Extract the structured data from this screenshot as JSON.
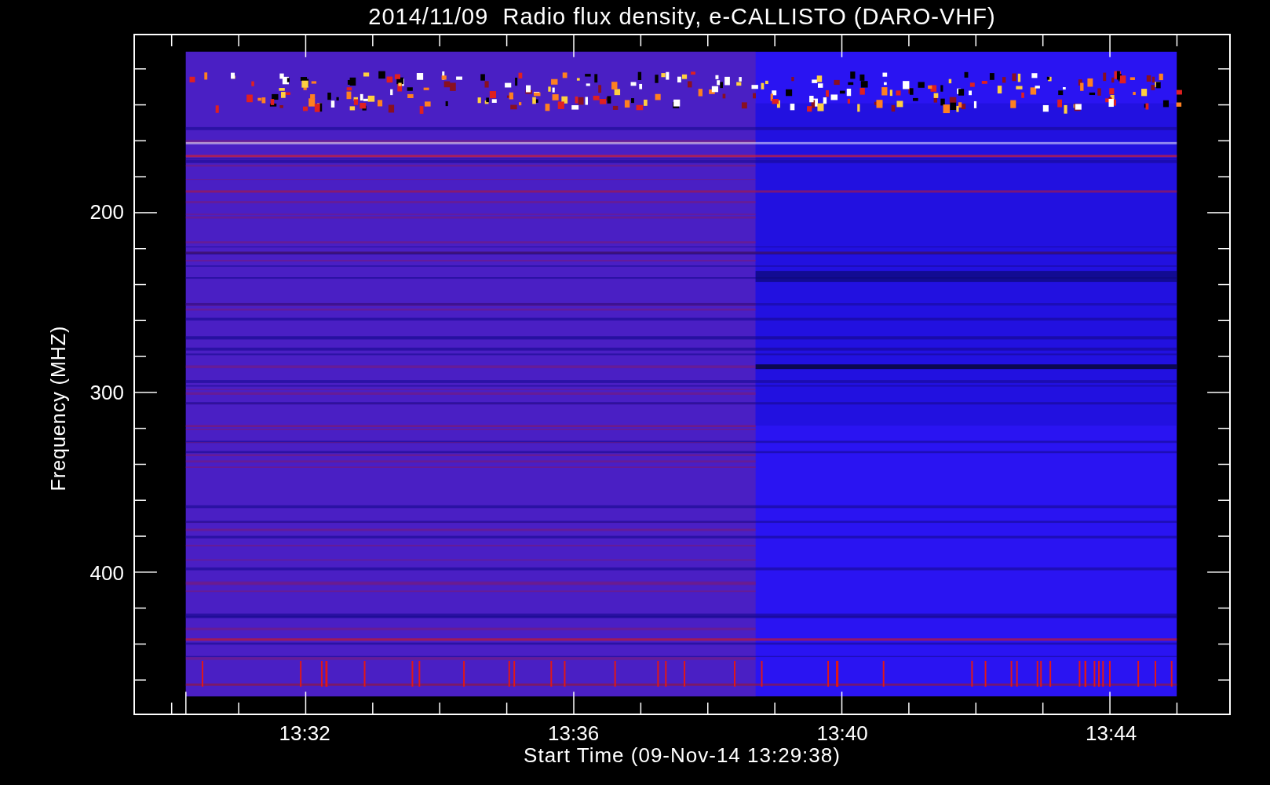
{
  "title": "2014/11/09  Radio flux density, e-CALLISTO (DARO-VHF)",
  "y_axis": {
    "label": "Frequency (MHZ)",
    "ticks": [
      "200",
      "300",
      "400"
    ]
  },
  "x_axis": {
    "label": "Start Time (09-Nov-14 13:29:38)",
    "ticks": [
      "13:32",
      "13:36",
      "13:40",
      "13:44"
    ]
  }
}
